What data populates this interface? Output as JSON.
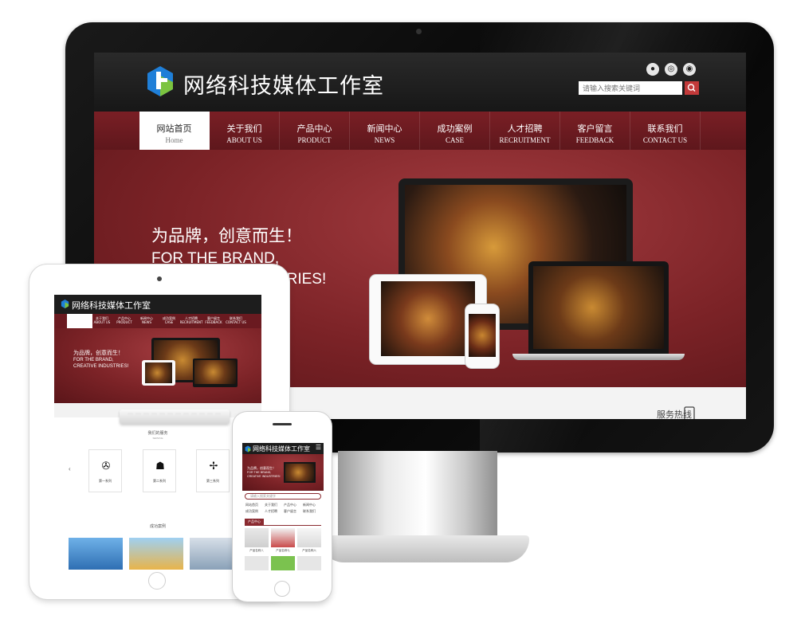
{
  "desktop": {
    "brand_title": "网络科技媒体工作室",
    "search": {
      "placeholder": "请输入搜索关键词"
    },
    "social_icons": [
      "qq-icon",
      "wechat-icon",
      "weibo-icon"
    ],
    "nav": [
      {
        "zh": "网站首页",
        "en": "Home",
        "active": true
      },
      {
        "zh": "关于我们",
        "en": "ABOUT US"
      },
      {
        "zh": "产品中心",
        "en": "PRODUCT"
      },
      {
        "zh": "新闻中心",
        "en": "NEWS"
      },
      {
        "zh": "成功案例",
        "en": "CASE"
      },
      {
        "zh": "人才招聘",
        "en": "RECRUITMENT"
      },
      {
        "zh": "客户留言",
        "en": "FEEDBACK"
      },
      {
        "zh": "联系我们",
        "en": "CONTACT US"
      }
    ],
    "banner": {
      "slogan_zh": "为品牌，创意而生！",
      "slogan_en_1": "FOR THE BRAND,",
      "slogan_en_2": "CREATIVE INDUSTRIES!"
    },
    "hotline_label": "服务热线",
    "colors": {
      "accent": "#6a1a20",
      "header_bg": "#1d1d1d",
      "search_button": "#c23a3a"
    }
  },
  "tablet": {
    "brand_title": "网络科技媒体工作室",
    "nav": [
      {
        "zh": "网站首页",
        "en": "HOME"
      },
      {
        "zh": "关于我们",
        "en": "ABOUT US"
      },
      {
        "zh": "产品中心",
        "en": "PRODUCT"
      },
      {
        "zh": "新闻中心",
        "en": "NEWS"
      },
      {
        "zh": "成功案例",
        "en": "CASE"
      },
      {
        "zh": "人才招聘",
        "en": "RECRUITMENT"
      },
      {
        "zh": "客户留言",
        "en": "FEEDBACK"
      },
      {
        "zh": "联系我们",
        "en": "CONTACT US"
      }
    ],
    "banner": {
      "slogan_zh": "为品牌，创意而生！",
      "slogan_en_1": "FOR THE BRAND,",
      "slogan_en_2": "CREATIVE INDUSTRIES!"
    },
    "services_title": "我们的服务",
    "services_sub": "SERVICE",
    "services": [
      {
        "label": "第一系列",
        "icon": "film-reel-icon"
      },
      {
        "label": "第二系列",
        "icon": "handshake-icon"
      },
      {
        "label": "第三系列",
        "icon": "pinwheel-icon"
      }
    ],
    "cases_title": "成功案例",
    "cases_sub": "CASE"
  },
  "phone": {
    "brand_title": "网络科技媒体工作室",
    "banner": {
      "slogan_zh": "为品牌，创意而生！",
      "slogan_en_1": "FOR THE BRAND,",
      "slogan_en_2": "CREATIVE INDUSTRIES!"
    },
    "search": {
      "placeholder": "请输入搜索关键字"
    },
    "nav": [
      "网站首页",
      "关于我们",
      "产品中心",
      "新闻中心",
      "成功案例",
      "人才招聘",
      "客户留言",
      "联系我们"
    ],
    "products_title": "产品中心",
    "products": [
      "产品名称八",
      "产品名称七",
      "产品名称六"
    ]
  }
}
